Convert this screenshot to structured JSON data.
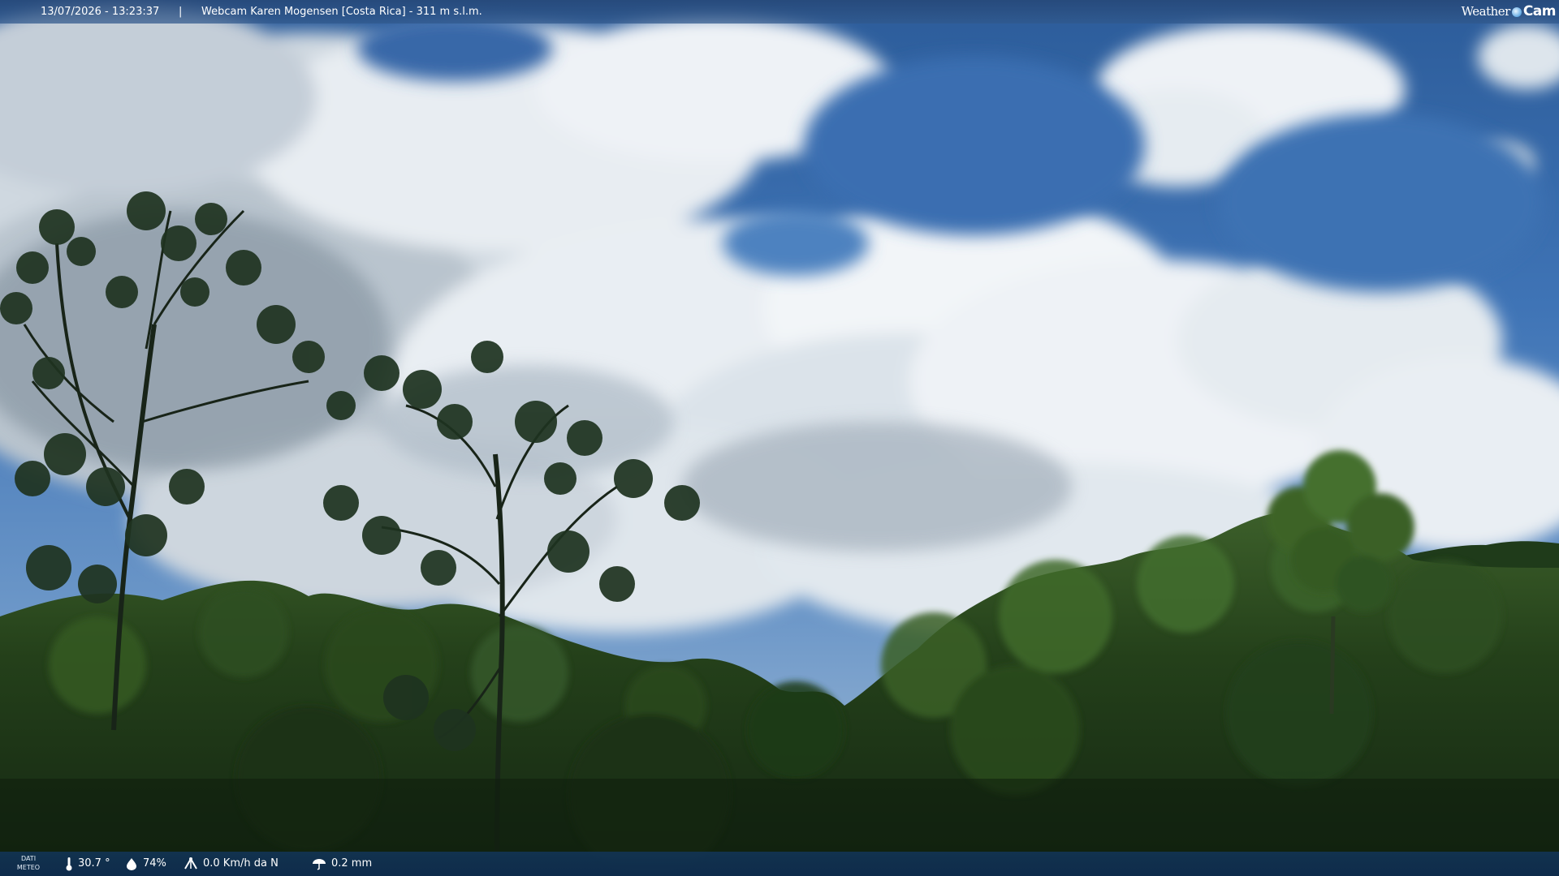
{
  "header": {
    "timestamp": "13/07/2026 - 13:23:37",
    "separator": "|",
    "camera_title": "Webcam Karen Mogensen [Costa Rica]  - 311 m s.l.m.",
    "brand_weather": "Weather",
    "brand_cam": "Cam"
  },
  "footer": {
    "meteo_label_line1": "DATI",
    "meteo_label_line2": "METEO",
    "temperature": "30.7 °",
    "humidity": "74%",
    "wind": "0.0 Km/h da N",
    "rain": "0.2 mm",
    "icons": [
      "thermometer-icon",
      "humidity-drop-icon",
      "wind-icon",
      "rain-gauge-icon"
    ]
  },
  "colors": {
    "sky_top": "#2e5f9e",
    "sky_mid": "#4f84c4",
    "cloud": "#e9eef3",
    "cloud_shadow": "#9aa8b5",
    "forest_dark": "#152a12",
    "forest_mid": "#2c4d1f",
    "forest_light": "#4d7033",
    "bar_top": "#264878",
    "bar_bottom": "#0e2c50"
  }
}
